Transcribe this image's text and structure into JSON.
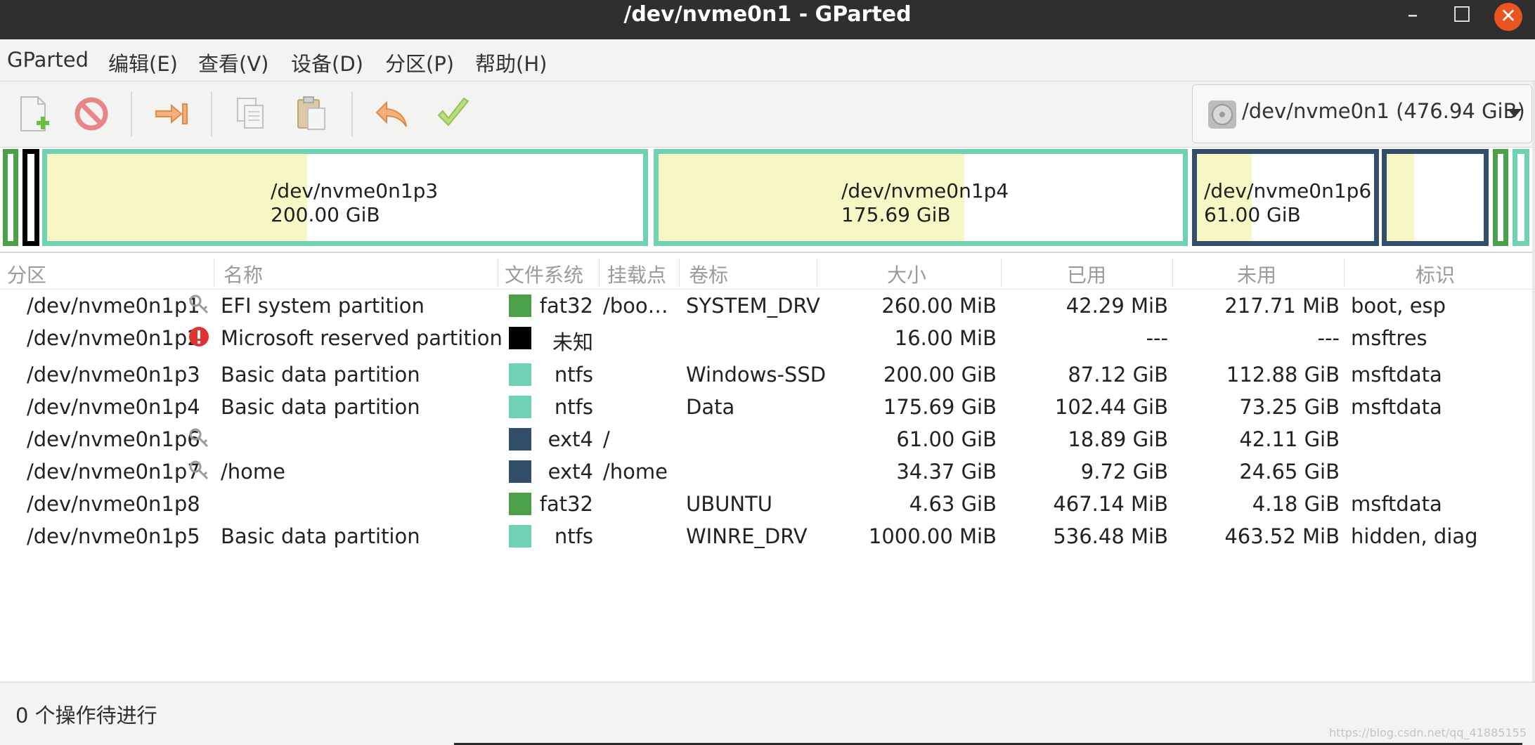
{
  "window": {
    "title": "/dev/nvme0n1 - GParted"
  },
  "menu": [
    "GParted",
    "编辑(E)",
    "查看(V)",
    "设备(D)",
    "分区(P)",
    "帮助(H)"
  ],
  "toolbar": {
    "icons": [
      "new-partition-icon",
      "delete-icon",
      "resize-move-icon",
      "copy-icon",
      "paste-icon",
      "undo-icon",
      "apply-icon"
    ],
    "device": "/dev/nvme0n1 (476.94 GiB)"
  },
  "graphic": [
    {
      "name": "/dev/nvme0n1p3",
      "size": "200.00 GiB",
      "color": "#70d2b4",
      "used_fraction": 0.436
    },
    {
      "name": "/dev/nvme0n1p4",
      "size": "175.69 GiB",
      "color": "#70d2b4",
      "used_fraction": 0.583
    },
    {
      "name": "/dev/nvme0n1p6",
      "size": "61.00 GiB",
      "color": "#324e6a",
      "used_fraction": 0.31
    },
    {
      "name": "",
      "size": "",
      "color": "#324e6a",
      "used_fraction": 0.283
    }
  ],
  "columns": [
    "分区",
    "名称",
    "文件系统",
    "挂载点",
    "卷标",
    "大小",
    "已用",
    "未用",
    "标识"
  ],
  "rows": [
    {
      "partition": "/dev/nvme0n1p1",
      "flag": "key",
      "name": "EFI system partition",
      "fs": "fat32",
      "fs_color": "#4aa14a",
      "mount": "/boo…",
      "label": "SYSTEM_DRV",
      "size": "260.00 MiB",
      "used": "42.29 MiB",
      "unused": "217.71 MiB",
      "flags": "boot, esp"
    },
    {
      "partition": "/dev/nvme0n1p2",
      "flag": "warning",
      "name": "Microsoft reserved partition",
      "fs": "未知",
      "fs_color": "#000000",
      "mount": "",
      "label": "",
      "size": "16.00 MiB",
      "used": "---",
      "unused": "---",
      "flags": "msftres"
    },
    {
      "partition": "/dev/nvme0n1p3",
      "flag": "",
      "name": "Basic data partition",
      "fs": "ntfs",
      "fs_color": "#70d2b4",
      "mount": "",
      "label": "Windows-SSD",
      "size": "200.00 GiB",
      "used": "87.12 GiB",
      "unused": "112.88 GiB",
      "flags": "msftdata"
    },
    {
      "partition": "/dev/nvme0n1p4",
      "flag": "",
      "name": "Basic data partition",
      "fs": "ntfs",
      "fs_color": "#70d2b4",
      "mount": "",
      "label": "Data",
      "size": "175.69 GiB",
      "used": "102.44 GiB",
      "unused": "73.25 GiB",
      "flags": "msftdata"
    },
    {
      "partition": "/dev/nvme0n1p6",
      "flag": "key",
      "name": "",
      "fs": "ext4",
      "fs_color": "#324e6a",
      "mount": "/",
      "label": "",
      "size": "61.00 GiB",
      "used": "18.89 GiB",
      "unused": "42.11 GiB",
      "flags": ""
    },
    {
      "partition": "/dev/nvme0n1p7",
      "flag": "key",
      "name": "/home",
      "fs": "ext4",
      "fs_color": "#324e6a",
      "mount": "/home",
      "label": "",
      "size": "34.37 GiB",
      "used": "9.72 GiB",
      "unused": "24.65 GiB",
      "flags": ""
    },
    {
      "partition": "/dev/nvme0n1p8",
      "flag": "",
      "name": "",
      "fs": "fat32",
      "fs_color": "#4aa14a",
      "mount": "",
      "label": "UBUNTU",
      "size": "4.63 GiB",
      "used": "467.14 MiB",
      "unused": "4.18 GiB",
      "flags": "msftdata"
    },
    {
      "partition": "/dev/nvme0n1p5",
      "flag": "",
      "name": "Basic data partition",
      "fs": "ntfs",
      "fs_color": "#70d2b4",
      "mount": "",
      "label": "WINRE_DRV",
      "size": "1000.00 MiB",
      "used": "536.48 MiB",
      "unused": "463.52 MiB",
      "flags": "hidden, diag"
    }
  ],
  "status": {
    "pending": "0 个操作待进行",
    "watermark": "https://blog.csdn.net/qq_41885155"
  }
}
